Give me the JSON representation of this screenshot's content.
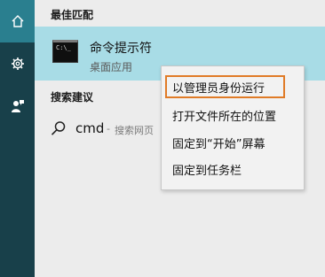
{
  "sidebar": {
    "buttons": [
      {
        "icon": "home-icon"
      },
      {
        "icon": "gear-icon"
      },
      {
        "icon": "user-feedback-icon"
      }
    ]
  },
  "best_match": {
    "header": "最佳匹配",
    "item": {
      "icon": "command-prompt-icon",
      "icon_text": "C:\\_",
      "title": "命令提示符",
      "subtitle": "桌面应用"
    }
  },
  "search_suggestions": {
    "header": "搜索建议",
    "items": [
      {
        "icon": "search-icon",
        "query": "cmd",
        "separator": "-",
        "hint": "搜索网页"
      }
    ]
  },
  "context_menu": {
    "items": [
      {
        "label": "以管理员身份运行",
        "highlighted": true
      },
      {
        "label": "打开文件所在的位置"
      },
      {
        "label": "固定到“开始”屏幕"
      },
      {
        "label": "固定到任务栏"
      }
    ],
    "highlight_color": "#e07b27"
  },
  "colors": {
    "sidebar": "#18404a",
    "sidebar_active": "#2a7f8f",
    "selection": "#a8dce6"
  }
}
